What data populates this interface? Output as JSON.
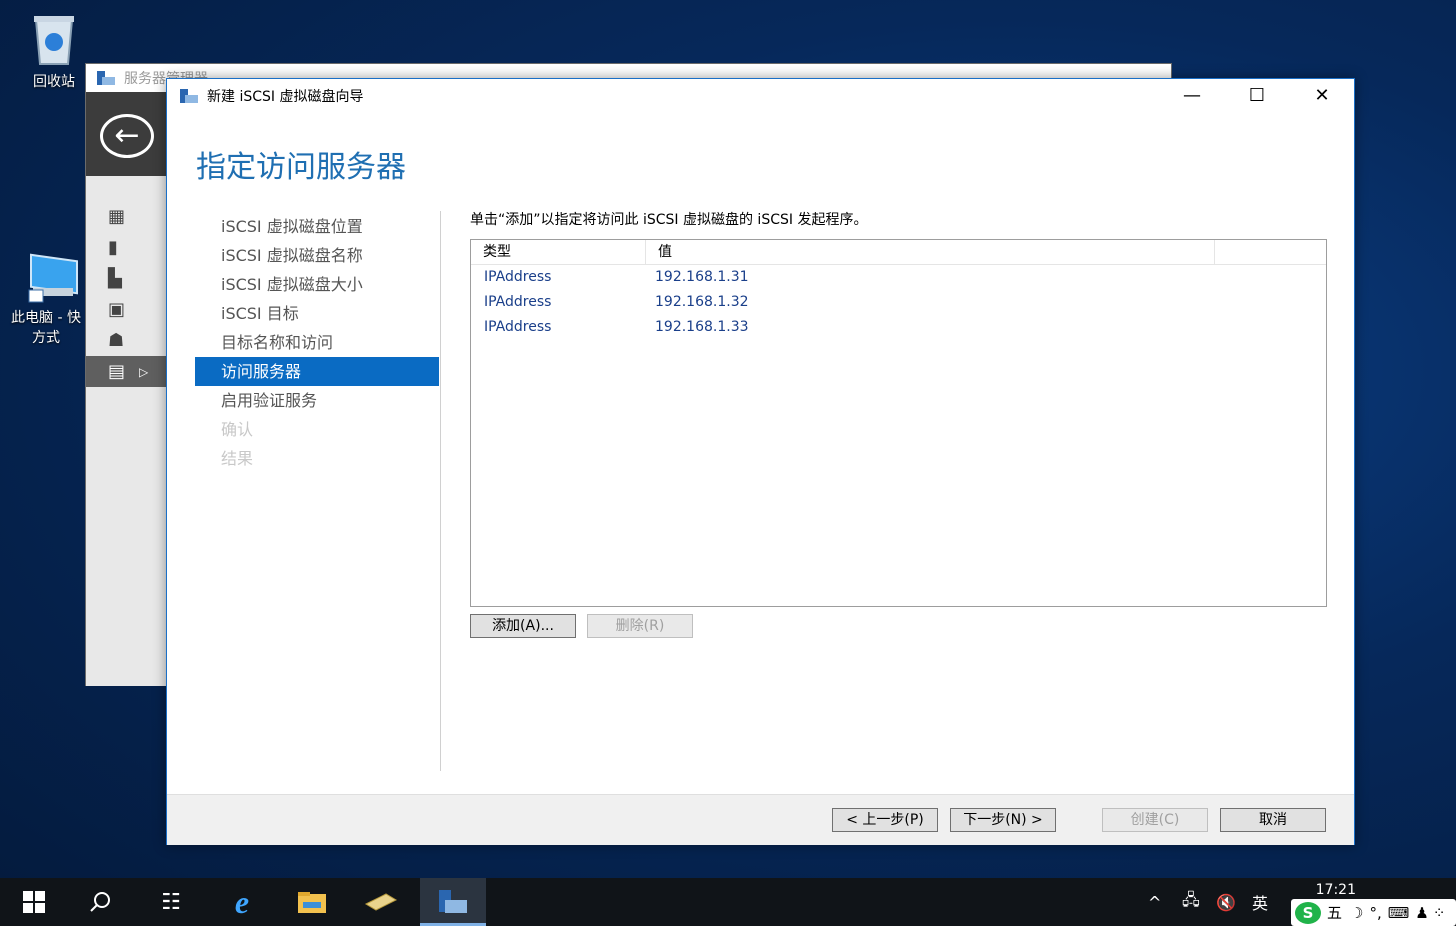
{
  "desktop": {
    "recycle_bin_label": "回收站",
    "this_pc_label_line1": "此电脑 - 快",
    "this_pc_label_line2": "方式"
  },
  "server_manager": {
    "title": "服务器管理器"
  },
  "wizard": {
    "title": "新建 iSCSI 虚拟磁盘向导",
    "page_title": "指定访问服务器",
    "steps": [
      {
        "label": "iSCSI 虚拟磁盘位置",
        "state": "normal"
      },
      {
        "label": "iSCSI 虚拟磁盘名称",
        "state": "normal"
      },
      {
        "label": "iSCSI 虚拟磁盘大小",
        "state": "normal"
      },
      {
        "label": "iSCSI 目标",
        "state": "normal"
      },
      {
        "label": "目标名称和访问",
        "state": "normal"
      },
      {
        "label": "访问服务器",
        "state": "active"
      },
      {
        "label": "启用验证服务",
        "state": "normal"
      },
      {
        "label": "确认",
        "state": "disabled"
      },
      {
        "label": "结果",
        "state": "disabled"
      }
    ],
    "instruction": "单击“添加”以指定将访问此 iSCSI 虚拟磁盘的 iSCSI 发起程序。",
    "table": {
      "columns": [
        "类型",
        "值"
      ],
      "rows": [
        {
          "type": "IPAddress",
          "value": "192.168.1.31"
        },
        {
          "type": "IPAddress",
          "value": "192.168.1.32"
        },
        {
          "type": "IPAddress",
          "value": "192.168.1.33"
        }
      ]
    },
    "add_button": "添加(A)...",
    "remove_button": "删除(R)",
    "prev_button": "< 上一步(P)",
    "next_button": "下一步(N) >",
    "create_button": "创建(C)",
    "cancel_button": "取消"
  },
  "taskbar": {
    "time": "17:21",
    "lang": "英",
    "ime_label": "五"
  },
  "colors": {
    "accent": "#0a6bc3",
    "title_blue": "#1f6fb2",
    "value_blue": "#1a3f8a"
  }
}
